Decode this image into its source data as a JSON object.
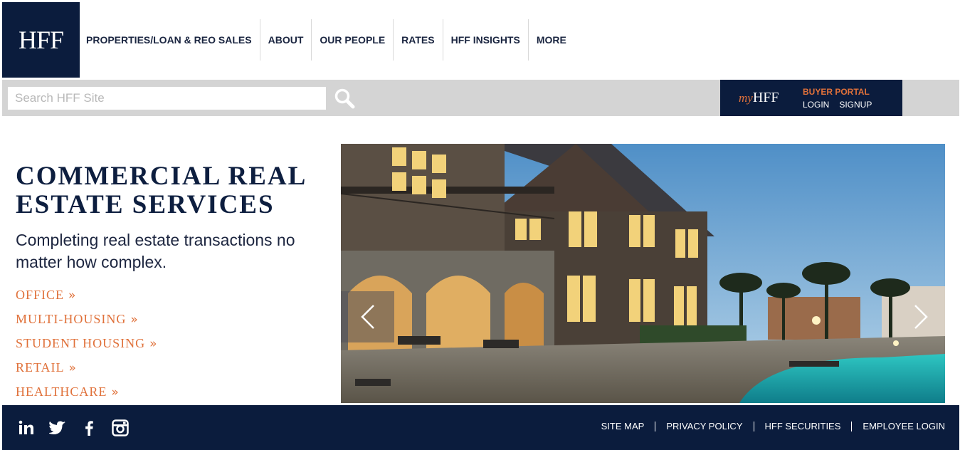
{
  "brand": {
    "logo_text": "HFF"
  },
  "nav": {
    "items": [
      {
        "label": "PROPERTIES/LOAN & REO SALES"
      },
      {
        "label": "ABOUT"
      },
      {
        "label": "OUR PEOPLE"
      },
      {
        "label": "RATES"
      },
      {
        "label": "HFF INSIGHTS"
      },
      {
        "label": "MORE"
      }
    ]
  },
  "search": {
    "placeholder": "Search HFF Site",
    "value": ""
  },
  "myhff": {
    "logo_prefix": "my",
    "logo_main": "HFF",
    "portal_title": "BUYER PORTAL",
    "login": "LOGIN",
    "signup": "SIGNUP"
  },
  "hero": {
    "title": "COMMERCIAL REAL ESTATE SERVICES",
    "subtitle": "Completing real estate transactions no matter how complex."
  },
  "categories": [
    {
      "label": "OFFICE"
    },
    {
      "label": "MULTI-HOUSING"
    },
    {
      "label": "STUDENT HOUSING"
    },
    {
      "label": "RETAIL"
    },
    {
      "label": "HEALTHCARE"
    }
  ],
  "footer": {
    "social": [
      "linkedin-icon",
      "twitter-icon",
      "facebook-icon",
      "instagram-icon"
    ],
    "links": [
      {
        "label": "SITE MAP"
      },
      {
        "label": "PRIVACY POLICY"
      },
      {
        "label": "HFF SECURITIES"
      },
      {
        "label": "EMPLOYEE LOGIN"
      }
    ]
  },
  "colors": {
    "navy": "#0b1c3d",
    "accent": "#e0713a",
    "search_bar": "#d4d4d4"
  }
}
